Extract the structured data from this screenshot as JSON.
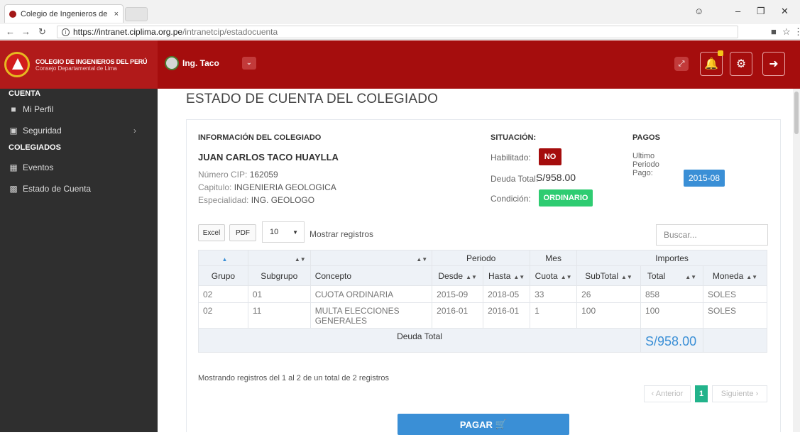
{
  "browser": {
    "tab_title": "Colegio de Ingenieros de",
    "tab_close": "×",
    "url_host": "https://intranet.ciplima.org.pe",
    "url_path": "/intranetcip/estadocuenta"
  },
  "header": {
    "brand_name": "COLEGIO DE INGENIEROS DEL PERÚ",
    "brand_sub": "Consejo Departamental de Lima",
    "user_name": "Ing. Taco"
  },
  "sidebar": {
    "section_cuenta": "CUENTA",
    "section_colegiados": "COLEGIADOS",
    "items": [
      {
        "label": "Mi Perfil"
      },
      {
        "label": "Seguridad"
      },
      {
        "label": "Eventos"
      },
      {
        "label": "Estado de Cuenta"
      }
    ]
  },
  "page": {
    "title": "ESTADO DE CUENTA DEL COLEGIADO"
  },
  "member": {
    "section_label": "INFORMACIÓN DEL COLEGIADO",
    "name": "JUAN CARLOS TACO HUAYLLA",
    "cip_label": "Número CIP: ",
    "cip_value": "162059",
    "capitulo_label": "Capitulo: ",
    "capitulo_value": "INGENIERIA GEOLOGICA",
    "especialidad_label": "Especialidad: ",
    "especialidad_value": "ING. GEOLOGO"
  },
  "situacion": {
    "section_label": "SITUACIÓN:",
    "habilitado_label": "Habilitado:",
    "habilitado_value": "NO",
    "deuda_label": "Deuda Total:",
    "deuda_value": "S/958.00",
    "condicion_label": "Condición:",
    "condicion_value": "ORDINARIO",
    "colors": {
      "no": "#a50d0d",
      "ordinario": "#2ecc71"
    }
  },
  "pagos": {
    "section_label": "PAGOS",
    "ultimo_label_1": "Ultimo",
    "ultimo_label_2": "Periodo",
    "ultimo_label_3": "Pago:",
    "ultimo_value": "2015-08",
    "color": "#3a8fd6"
  },
  "toolbar": {
    "excel_label": "Excel",
    "pdf_label": "PDF",
    "page_size": "10",
    "mostrar_label": "Mostrar registros",
    "search_placeholder": "Buscar..."
  },
  "table": {
    "group_headers": {
      "periodo": "Periodo",
      "mes": "Mes",
      "importes": "Importes"
    },
    "columns": [
      "Grupo",
      "Subgrupo",
      "Concepto",
      "Desde",
      "Hasta",
      "Cuota",
      "SubTotal",
      "Total",
      "Moneda"
    ],
    "rows": [
      [
        "02",
        "01",
        "CUOTA ORDINARIA",
        "2015-09",
        "2018-05",
        "33",
        "26",
        "858",
        "SOLES"
      ],
      [
        "02",
        "11",
        "MULTA ELECCIONES GENERALES",
        "2016-01",
        "2016-01",
        "1",
        "100",
        "100",
        "SOLES"
      ]
    ],
    "footer_label": "Deuda Total",
    "footer_total": "S/958.00"
  },
  "pagination": {
    "showing_text": "Mostrando registros del 1 al 2 de un total de 2 registros",
    "prev_label": "‹ Anterior",
    "current_page": "1",
    "next_label": "Siguiente ›"
  },
  "actions": {
    "pay_label": "PAGAR"
  }
}
